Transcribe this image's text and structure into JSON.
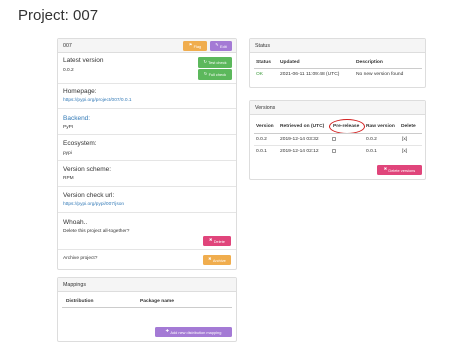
{
  "page": {
    "title": "Project: 007"
  },
  "project_panel": {
    "title": "007",
    "flag_label": "Flag",
    "edit_label": "Edit",
    "test_check_label": "Test check",
    "full_check_label": "Full check",
    "latest_version_label": "Latest version",
    "latest_version": "0.0.2",
    "homepage_label": "Homepage:",
    "homepage": "https://pypi.org/project/007/0.0.1",
    "backend_label": "Backend:",
    "backend": "PyPI",
    "ecosystem_label": "Ecosystem:",
    "ecosystem": "pypi",
    "version_scheme_label": "Version scheme:",
    "version_scheme": "RPM",
    "version_check_url_label": "Version check url:",
    "version_check_url": "https://pypi.org/pypi/007/json",
    "whoah_label": "Whoah..",
    "delete_question": "Delete this project all-together?",
    "delete_label": "Delete",
    "archive_question": "Archive project?",
    "archive_label": "Archive"
  },
  "mappings_panel": {
    "title": "Mappings",
    "columns": [
      "Distribution",
      "Package name"
    ],
    "add_label": "Add new distribution mapping"
  },
  "status_panel": {
    "title": "Status",
    "columns": [
      "Status",
      "Updated",
      "Description"
    ],
    "row": {
      "status": "OK",
      "updated": "2021-06-11 11:09:48 (UTC)",
      "description": "No new version found"
    }
  },
  "versions_panel": {
    "title": "Versions",
    "columns": [
      "Version",
      "Retrieved on (UTC)",
      "Pre-release",
      "Raw version",
      "Delete"
    ],
    "rows": [
      {
        "version": "0.0.2",
        "retrieved": "2019-12-14 03:32",
        "raw": "0.0.2",
        "delete": "[x]"
      },
      {
        "version": "0.0.1",
        "retrieved": "2019-12-14 02:12",
        "raw": "0.0.1",
        "delete": "[x]"
      }
    ],
    "delete_versions_label": "Delete versions"
  },
  "colors": {
    "accent_link": "#337ab7",
    "ok_green": "#3c9b3c",
    "annotation_ring": "#d21f1f"
  }
}
